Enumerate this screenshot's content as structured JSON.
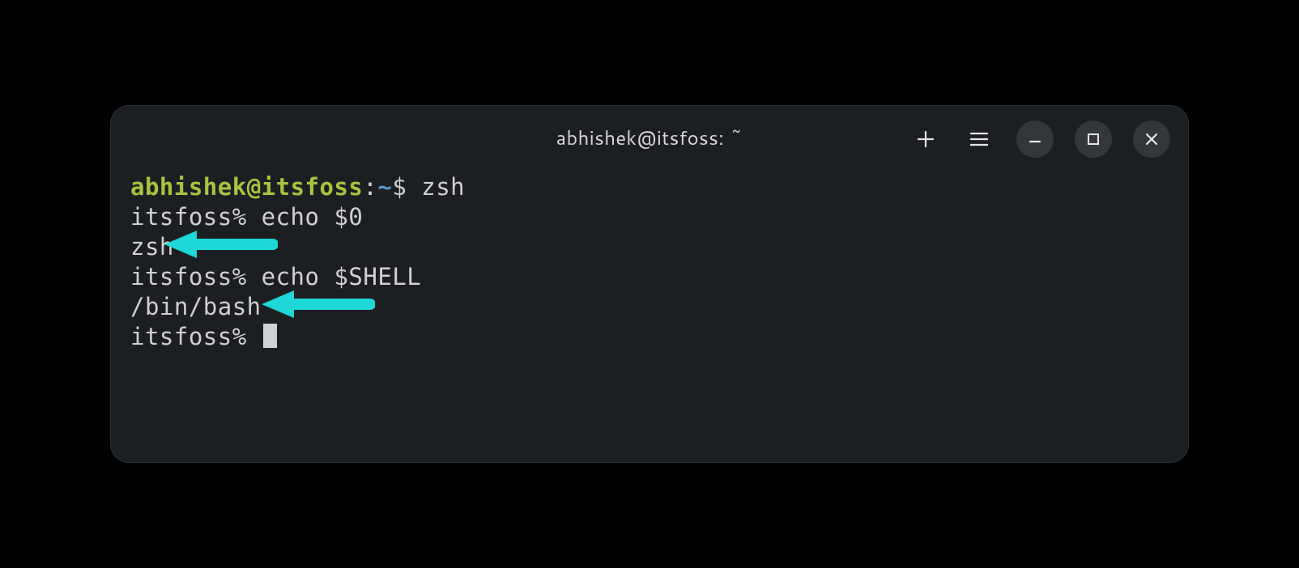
{
  "window": {
    "title": "abhishek@itsfoss: ~"
  },
  "colors": {
    "prompt_user": "#a7c43f",
    "prompt_path": "#5e97d0",
    "annotation_arrow": "#1ed7d7"
  },
  "terminal": {
    "bash_prompt": {
      "user": "abhishek",
      "at": "@",
      "host": "itsfoss",
      "colon": ":",
      "path": "~",
      "dollar": "$ "
    },
    "zsh_prompt": "itsfoss% ",
    "lines": [
      {
        "type": "bash_prompt",
        "command": "zsh"
      },
      {
        "type": "zsh_prompt",
        "command": "echo $0"
      },
      {
        "type": "output",
        "text": "zsh"
      },
      {
        "type": "zsh_prompt",
        "command": "echo $SHELL"
      },
      {
        "type": "output",
        "text": "/bin/bash"
      },
      {
        "type": "zsh_prompt_cursor"
      }
    ]
  },
  "annotations": {
    "arrows": [
      {
        "points_to": "zsh output"
      },
      {
        "points_to": "/bin/bash output"
      }
    ]
  }
}
